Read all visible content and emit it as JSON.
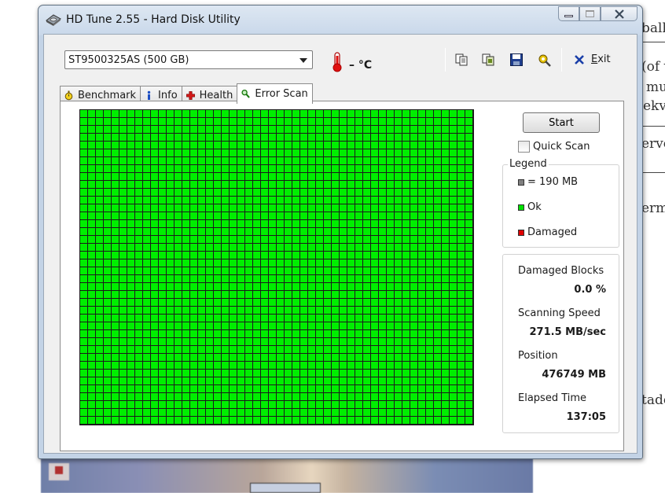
{
  "window": {
    "title": "HD Tune 2.55 - Hard Disk Utility"
  },
  "toolbar": {
    "drive": "ST9500325AS (500 GB)",
    "temperature": "– °C",
    "exit_hotkey": "E",
    "exit_rest": "xit"
  },
  "tabs": [
    {
      "label": "Benchmark",
      "icon": "stopwatch-icon"
    },
    {
      "label": "Info",
      "icon": "info-icon"
    },
    {
      "label": "Health",
      "icon": "health-cross-icon"
    },
    {
      "label": "Error Scan",
      "icon": "magnifier-icon",
      "active": true
    }
  ],
  "error_scan": {
    "start_label": "Start",
    "quick_scan_label": "Quick Scan",
    "quick_scan_checked": false,
    "grid_status": "ok",
    "legend": {
      "title": "Legend",
      "items": [
        {
          "label": "= 190 MB",
          "color": "#808080"
        },
        {
          "label": "Ok",
          "color": "#00e000"
        },
        {
          "label": "Damaged",
          "color": "#e00000"
        }
      ]
    },
    "stats": {
      "damaged_blocks_label": "Damaged Blocks",
      "damaged_blocks_value": "0.0 %",
      "speed_label": "Scanning Speed",
      "speed_value": "271.5 MB/sec",
      "position_label": "Position",
      "position_value": "476749 MB",
      "elapsed_label": "Elapsed Time",
      "elapsed_value": "137:05"
    }
  },
  "colors": {
    "ok": "#00ee00",
    "damaged": "#e00000",
    "block_size_marker": "#808080"
  },
  "background_document": {
    "fragments": [
      "balk",
      "(of v",
      "mu",
      "ekv",
      "ervol",
      "erm",
      "tade"
    ]
  }
}
